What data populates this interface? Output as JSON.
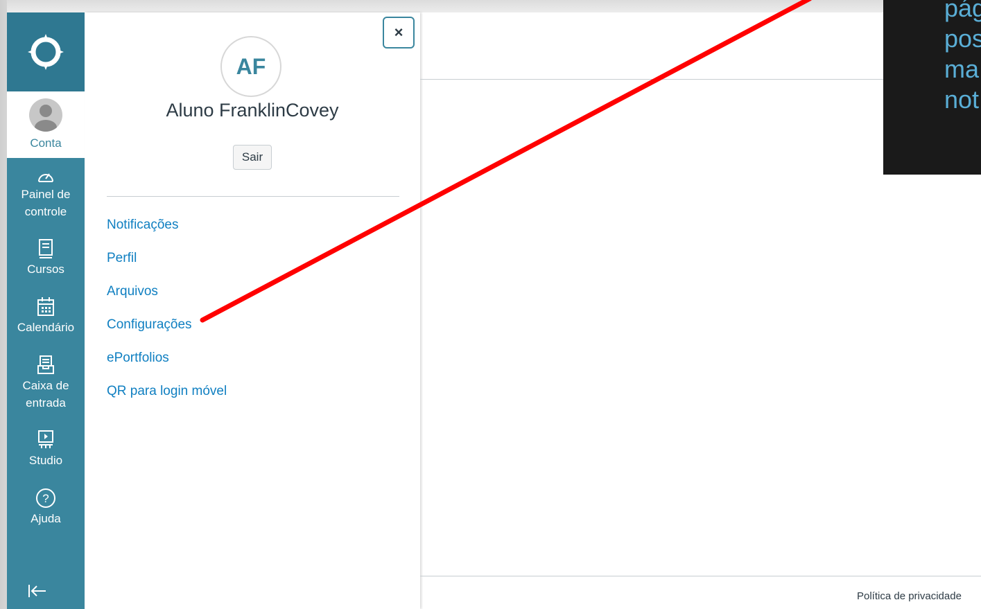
{
  "nav": {
    "account_label": "Conta",
    "items": [
      {
        "label_line1": "Painel de",
        "label_line2": "controle",
        "icon": "dashboard-icon"
      },
      {
        "label_line1": "Cursos",
        "label_line2": "",
        "icon": "courses-icon"
      },
      {
        "label_line1": "Calendário",
        "label_line2": "",
        "icon": "calendar-icon"
      },
      {
        "label_line1": "Caixa de",
        "label_line2": "entrada",
        "icon": "inbox-icon"
      },
      {
        "label_line1": "Studio",
        "label_line2": "",
        "icon": "studio-icon"
      },
      {
        "label_line1": "Ajuda",
        "label_line2": "",
        "icon": "help-icon"
      }
    ],
    "collapse_icon": "collapse-arrow-icon"
  },
  "tray": {
    "close_symbol": "×",
    "initials": "AF",
    "user_name": "Aluno FranklinCovey",
    "logout_label": "Sair",
    "links": [
      "Notificações",
      "Perfil",
      "Arquivos",
      "Configurações",
      "ePortfolios",
      "QR para login móvel"
    ]
  },
  "footer": {
    "privacy_link": "Política de privacidade"
  },
  "overlay_note": {
    "lines": [
      "pág",
      "pos",
      "ma",
      "not"
    ]
  },
  "colors": {
    "nav_bg": "#3a869e",
    "link": "#0f7fc1",
    "arrow": "#ff0000",
    "note_text": "#5aaed6"
  }
}
